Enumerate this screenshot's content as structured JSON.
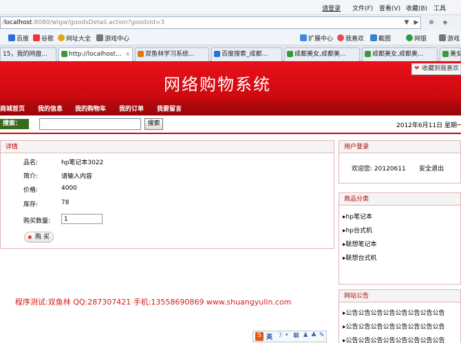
{
  "browser": {
    "login_link": "请登录",
    "menu": [
      "文件(F)",
      "查看(V)",
      "收藏(B)",
      "工具"
    ],
    "url_host": "localhost",
    "url_rest": ":8080/wlgw/goodsDetail.action?goodsId=3",
    "bookmarks": [
      "百度",
      "谷歌",
      "网址大全",
      "游戏中心"
    ],
    "toolbar_right": [
      "扩展中心",
      "我喜欢",
      "截图",
      "网银",
      "游戏"
    ],
    "tabs": [
      {
        "label": "15，我的网盘..."
      },
      {
        "label": "http://localhost..."
      },
      {
        "label": "双鱼林学习系统..."
      },
      {
        "label": "百度搜索_成都..."
      },
      {
        "label": "成都美女,成都美..."
      },
      {
        "label": "成都美女,成都美..."
      },
      {
        "label": "美女"
      }
    ],
    "colors": {
      "chrome_bg": "#eef2f7",
      "tab_border": "#b4bfcd"
    }
  },
  "site": {
    "title": "网络购物系统",
    "favorite": "收藏到我喜欢",
    "nav": [
      "商城首页",
      "我的信息",
      "我的购物车",
      "我的订单",
      "我要留言"
    ],
    "search_label": "搜索：",
    "search_value": "",
    "search_button": "搜索",
    "date": "2012年6月11日 星期一",
    "colors": {
      "brand_red": "#d60c12",
      "nav_red": "#a8070b",
      "search_green": "#3a6a1c"
    }
  },
  "detail": {
    "heading": "详情",
    "name_label": "品名:",
    "name_value": "hp笔记本3022",
    "intro_label": "简介:",
    "intro_value": "请输入内容",
    "price_label": "价格:",
    "price_value": "4000",
    "stock_label": "库存:",
    "stock_value": "78",
    "qty_label": "购买数量:",
    "qty_value": "1",
    "buy_button": "购 买"
  },
  "footer": {
    "credit": "程序测试:双鱼林 QQ:287307421 手机:13558690869 www.shuangyulin.com"
  },
  "sidebar": {
    "login_heading": "用户登录",
    "welcome": "欢迎您: 20120611",
    "logout": "安全退出",
    "category_heading": "商品分类",
    "categories": [
      "hp笔记本",
      "hp台式机",
      "联想笔记本",
      "联想台式机"
    ],
    "notice_heading": "网站公告",
    "notices": [
      "公告公告公告公告公告公告公告公告",
      "公告公告公告公告公告公告公告公告",
      "公告公告公告公告公告公告公告公告"
    ]
  },
  "ime": {
    "label": "英"
  }
}
